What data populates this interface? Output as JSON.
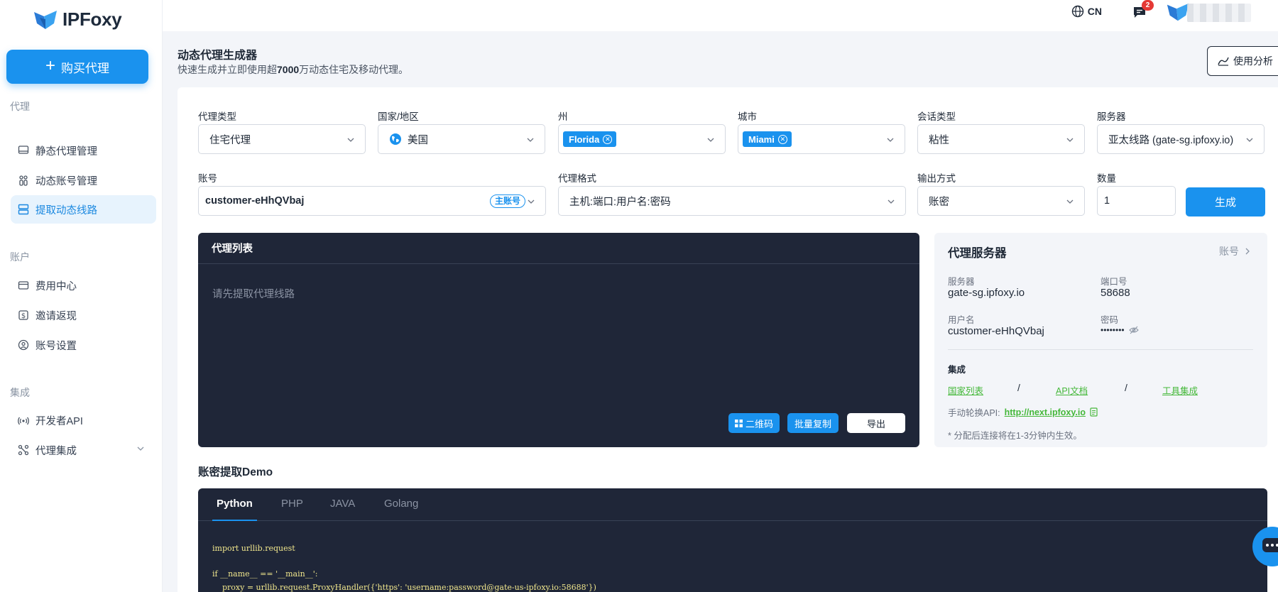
{
  "brand": {
    "name": "IPFoxy"
  },
  "sidebar": {
    "buy_button": "购买代理",
    "sections": {
      "proxy": "代理",
      "account": "账户",
      "integration": "集成"
    },
    "items": {
      "static_proxy": "静态代理管理",
      "dynamic_account": "动态账号管理",
      "extract_dynamic": "提取动态线路",
      "billing": "费用中心",
      "invite": "邀请返现",
      "account_settings": "账号设置",
      "developer_api": "开发者API",
      "proxy_integration": "代理集成"
    }
  },
  "topbar": {
    "language": "CN",
    "message_count": "2"
  },
  "page": {
    "title": "动态代理生成器",
    "subtitle_before": "快速生成并立即使用超",
    "subtitle_bold": "7000",
    "subtitle_after": "万动态住宅及移动代理。",
    "analysis_button": "使用分析"
  },
  "form": {
    "proxy_type": {
      "label": "代理类型",
      "value": "住宅代理"
    },
    "country": {
      "label": "国家/地区",
      "value": "美国"
    },
    "state": {
      "label": "州",
      "tag": "Florida"
    },
    "city": {
      "label": "城市",
      "tag": "Miami"
    },
    "session": {
      "label": "会话类型",
      "value": "粘性"
    },
    "server": {
      "label": "服务器",
      "value": "亚太线路 (gate-sg.ipfoxy.io)"
    },
    "account": {
      "label": "账号",
      "value": "customer-eHhQVbaj",
      "badge": "主账号"
    },
    "format": {
      "label": "代理格式",
      "value": "主机:端口:用户名:密码"
    },
    "output": {
      "label": "输出方式",
      "value": "账密"
    },
    "quantity": {
      "label": "数量",
      "value": "1"
    },
    "generate_button": "生成"
  },
  "proxy_list": {
    "title": "代理列表",
    "empty_text": "请先提取代理线路",
    "qr_button": "二维码",
    "copy_button": "批量复制",
    "export_button": "导出"
  },
  "server_info": {
    "title": "代理服务器",
    "account_link": "账号",
    "server_label": "服务器",
    "server_value": "gate-sg.ipfoxy.io",
    "port_label": "端口号",
    "port_value": "58688",
    "username_label": "用户名",
    "username_value": "customer-eHhQVbaj",
    "password_label": "密码",
    "password_value": "••••••••",
    "integration_label": "集成",
    "links": [
      "国家列表",
      "API文档",
      "工具集成"
    ],
    "separator": "/",
    "rotate_label": "手动轮换API:",
    "rotate_url": "http://next.ipfoxy.io",
    "note": "* 分配后连接将在1-3分钟内生效。"
  },
  "demo": {
    "title": "账密提取Demo",
    "tabs": [
      "Python",
      "PHP",
      "JAVA",
      "Golang"
    ],
    "code": [
      "import urllib.request",
      "if __name__ == '__main__':",
      "    proxy = urllib.request.ProxyHandler({'https': 'username:password@gate-us-ipfoxy.io:58688'})"
    ]
  },
  "colors": {
    "accent": "#1a92ee",
    "dark_panel": "#1f2638",
    "link_green": "#45b83a"
  }
}
